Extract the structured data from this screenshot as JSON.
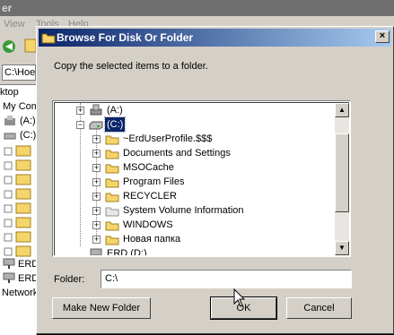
{
  "background": {
    "title_fragment": "er",
    "menu": [
      "View",
      "Tools",
      "Help"
    ],
    "address_fragment": "C:\\Hoe",
    "tree": [
      "ktop",
      "My Com",
      "(A:)",
      "(C:)",
      "ERD",
      "ERD",
      "Network"
    ]
  },
  "dialog": {
    "title": "Browse For Disk Or Folder",
    "instruction": "Copy the selected items to a folder.",
    "tree": [
      {
        "label": "(A:)",
        "icon": "floppy-drive-icon",
        "level": 1
      },
      {
        "label": "(C:)",
        "icon": "hard-drive-icon",
        "level": 1,
        "selected": true
      },
      {
        "label": "~ErdUserProfile.$$$",
        "icon": "folder-icon",
        "level": 2
      },
      {
        "label": "Documents and Settings",
        "icon": "folder-icon",
        "level": 2
      },
      {
        "label": "MSOCache",
        "icon": "folder-icon",
        "level": 2
      },
      {
        "label": "Program Files",
        "icon": "folder-icon",
        "level": 2
      },
      {
        "label": "RECYCLER",
        "icon": "folder-icon",
        "level": 2
      },
      {
        "label": "System Volume Information",
        "icon": "folder-icon",
        "level": 2
      },
      {
        "label": "WINDOWS",
        "icon": "folder-icon",
        "level": 2
      },
      {
        "label": "Новая папка",
        "icon": "folder-icon",
        "level": 2
      },
      {
        "label": "ERD (D:)",
        "icon": "network-drive-icon",
        "level": 1,
        "partial": true
      }
    ],
    "folder_label": "Folder:",
    "folder_value": "C:\\",
    "buttons": {
      "make_new_folder": "Make New Folder",
      "ok": "OK",
      "cancel": "Cancel"
    },
    "close_glyph": "×"
  },
  "colors": {
    "title_gradient_start": "#0a246a",
    "title_gradient_end": "#a6caf0",
    "selection": "#0a246a",
    "folder": "#f5d46b"
  }
}
